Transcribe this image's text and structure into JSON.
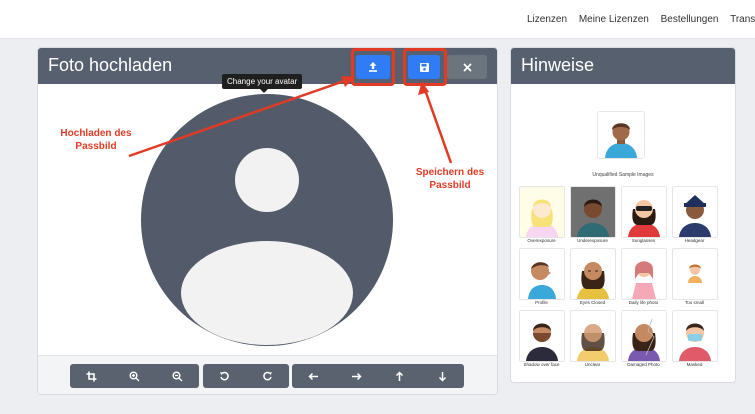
{
  "topnav": {
    "links": [
      "Lizenzen",
      "Meine Lizenzen",
      "Bestellungen",
      "Transf"
    ]
  },
  "upload": {
    "title": "Foto hochladen",
    "tooltip": "Change your avatar",
    "buttons": {
      "upload_icon": "upload-icon",
      "save_icon": "save-icon",
      "close_icon": "close-icon"
    },
    "toolbar": [
      "crop-icon",
      "zoom-in-icon",
      "zoom-out-icon",
      "rotate-left-icon",
      "rotate-right-icon",
      "arrow-left-icon",
      "arrow-right-icon",
      "arrow-up-icon",
      "arrow-down-icon"
    ]
  },
  "hints": {
    "title": "Hinweise",
    "caption": "Unqualified Sample Images",
    "samples": [
      {
        "label": "Overexposure"
      },
      {
        "label": "Underexposure"
      },
      {
        "label": "Sunglasses"
      },
      {
        "label": "Headgear"
      },
      {
        "label": "Profile"
      },
      {
        "label": "Eyes Closed"
      },
      {
        "label": "Daily life photo"
      },
      {
        "label": "Too small"
      },
      {
        "label": "Shadow over face"
      },
      {
        "label": "Unclear"
      },
      {
        "label": "Damaged Photo"
      },
      {
        "label": "Masked"
      }
    ]
  },
  "annotations": {
    "upload_callout": "Hochladen des\nPassbild",
    "save_callout": "Speichern des\nPassbild"
  },
  "colors": {
    "header": "#56606e",
    "primary": "#2f7cf6",
    "annotation": "#e23b25",
    "avatar": "#535b6a"
  }
}
